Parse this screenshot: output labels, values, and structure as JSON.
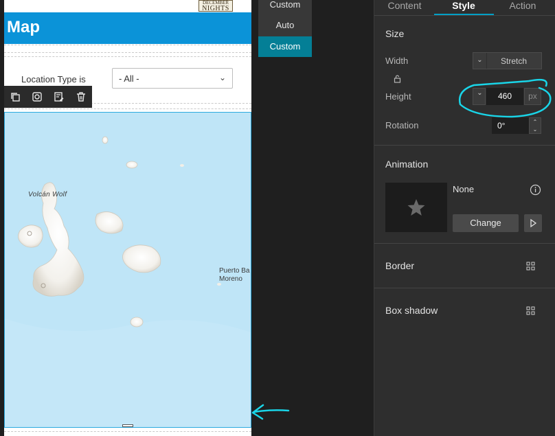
{
  "preview": {
    "logo": {
      "line1": "DECEMBER",
      "line2": "NIGHTS"
    },
    "header_title": "Map",
    "filter": {
      "label": "Location Type is",
      "selected": "- All -"
    },
    "map_labels": [
      "Volcán Wolf",
      "Puerto Ba",
      "Moreno"
    ]
  },
  "size_menu": {
    "items": [
      {
        "label": "Custom",
        "selected": false
      },
      {
        "label": "Auto",
        "selected": false
      },
      {
        "label": "Custom",
        "selected": true
      }
    ]
  },
  "panel": {
    "tabs": [
      {
        "label": "Content",
        "active": false
      },
      {
        "label": "Style",
        "active": true
      },
      {
        "label": "Action",
        "active": false
      }
    ],
    "size": {
      "title": "Size",
      "width_label": "Width",
      "width_value": "Stretch",
      "height_label": "Height",
      "height_value": "460",
      "height_unit": "px",
      "rotation_label": "Rotation",
      "rotation_value": "0°"
    },
    "animation": {
      "title": "Animation",
      "value": "None",
      "change_label": "Change"
    },
    "border": {
      "title": "Border"
    },
    "box_shadow": {
      "title": "Box shadow"
    }
  },
  "colors": {
    "header_blue": "#0b93d8",
    "accent_teal": "#047f96",
    "annotation_cyan": "#19d5e8",
    "panel_bg": "#2e2e2e"
  }
}
